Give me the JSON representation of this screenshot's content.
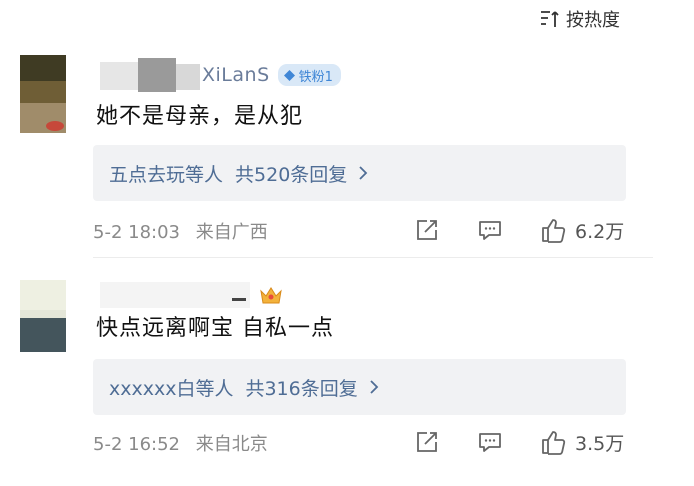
{
  "sort": {
    "label": "按热度",
    "icon": "sort-icon"
  },
  "comments": [
    {
      "username": "XiLanS",
      "badge": "铁粉1",
      "text": "她不是母亲，是从犯",
      "replies": {
        "names": "五点去玩等人",
        "count": "共520条回复"
      },
      "meta": {
        "date": "5-2 18:03",
        "location": "来自广西"
      },
      "likes": "6.2万"
    },
    {
      "username": "",
      "text": "快点远离啊宝 自私一点",
      "replies": {
        "names": "xxxxxx白等人",
        "count": "共316条回复"
      },
      "meta": {
        "date": "5-2 16:52",
        "location": "来自北京"
      },
      "likes": "3.5万"
    }
  ]
}
